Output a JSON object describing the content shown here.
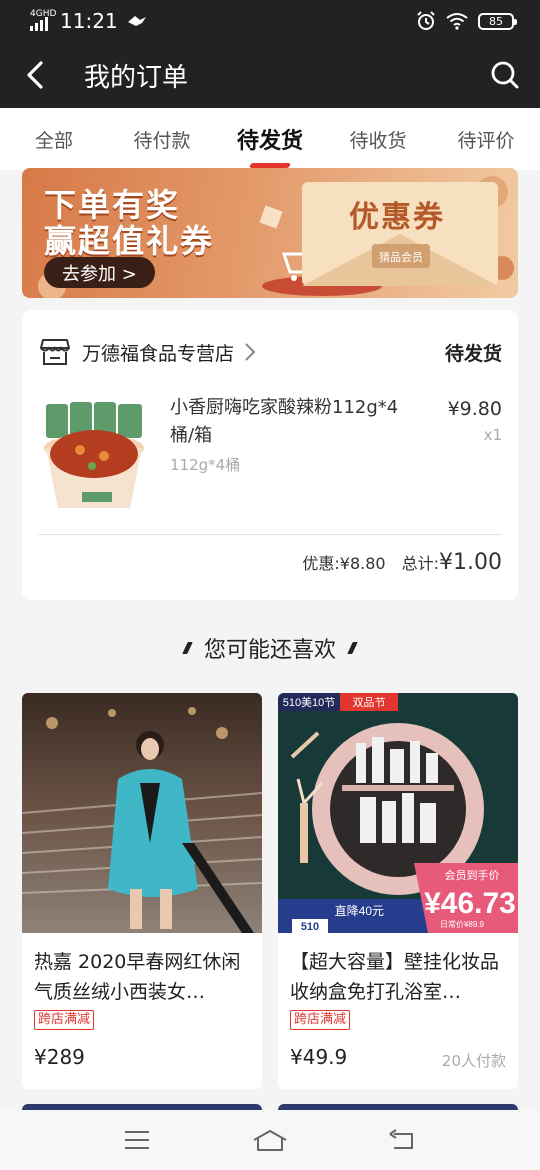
{
  "status_bar": {
    "network": "4GHD",
    "time": "11:21",
    "battery": "85"
  },
  "header": {
    "title": "我的订单"
  },
  "tabs": [
    {
      "label": "全部"
    },
    {
      "label": "待付款"
    },
    {
      "label": "待发货",
      "active": true
    },
    {
      "label": "待收货"
    },
    {
      "label": "待评价"
    }
  ],
  "banner": {
    "headline_1": "下单有奖",
    "headline_2": "赢超值礼券",
    "cta": "去参加 >",
    "coupon_label": "优惠券"
  },
  "order": {
    "shop_name": "万德福食品专营店",
    "status": "待发货",
    "product_name": "小香厨嗨吃家酸辣粉112g*4桶/箱",
    "product_spec": "112g*4桶",
    "price": "¥9.80",
    "quantity": "x1",
    "discount_label": "优惠:¥8.80",
    "total_label": "总计:",
    "total_value": "¥1.00"
  },
  "recommend": {
    "title": "您可能还喜欢",
    "items": [
      {
        "name": "热嘉 2020早春网红休闲气质丝绒小西装女…",
        "tag": "跨店满减",
        "price": "¥289",
        "paid": ""
      },
      {
        "name": "【超大容量】壁挂化妆品收纳盒免打孔浴室…",
        "tag": "跨店满减",
        "price": "¥49.9",
        "paid": "20人付款",
        "badge_event": "510美10节",
        "badge_festival": "双品节",
        "promo_drop": "直降40元",
        "promo_member": "会员到手价",
        "promo_price": "¥46.73",
        "promo_daily": "日常价¥89.9",
        "promo_510": "510"
      }
    ]
  },
  "colors": {
    "accent": "#e23530",
    "header_bg": "#222222"
  }
}
